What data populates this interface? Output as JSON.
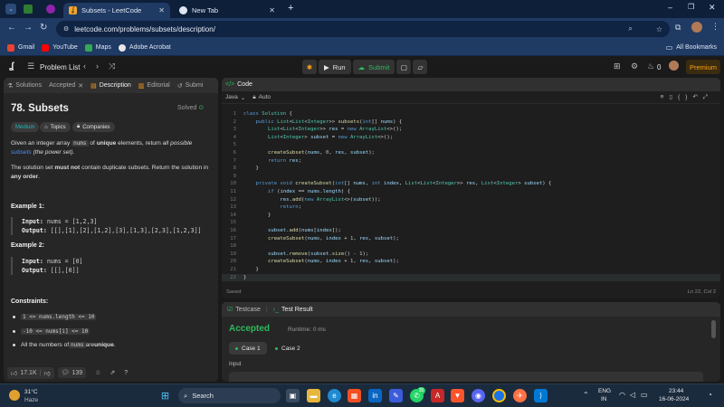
{
  "browser": {
    "tabs": [
      {
        "title": "Subsets - LeetCode",
        "active": true
      },
      {
        "title": "New Tab",
        "active": false
      }
    ],
    "url": "leetcode.com/problems/subsets/description/",
    "bookmarks": [
      {
        "label": "Gmail",
        "color": "#ea4335"
      },
      {
        "label": "YouTube",
        "color": "#ff0000"
      },
      {
        "label": "Maps",
        "color": "#34a853"
      },
      {
        "label": "Adobe Acrobat",
        "color": "#e8e8e8"
      }
    ],
    "all_bookmarks": "All Bookmarks"
  },
  "nav": {
    "problem_list": "Problem List",
    "run": "Run",
    "submit": "Submit",
    "streak": "0",
    "premium": "Premium"
  },
  "left": {
    "tabs": [
      "Solutions",
      "Accepted",
      "Description",
      "Editorial",
      "Submi"
    ],
    "title": "78. Subsets",
    "solved": "Solved",
    "difficulty": "Medium",
    "topics": "Topics",
    "companies": "Companies",
    "desc1_pre": "Given an integer array ",
    "desc1_code": "nums",
    "desc1_mid": " of ",
    "desc1_bold": "unique",
    "desc1_post": " elements, return ",
    "desc1_italic": "all possible",
    "desc1_link": "subsets",
    "desc1_end": " (the power set).",
    "desc2_pre": "The solution set ",
    "desc2_bold1": "must not",
    "desc2_mid": " contain duplicate subsets. Return the solution in ",
    "desc2_bold2": "any order",
    "desc2_end": ".",
    "example1_title": "Example 1:",
    "example1_input_label": "Input:",
    "example1_input": "nums = [1,2,3]",
    "example1_output_label": "Output:",
    "example1_output": "[[],[1],[2],[1,2],[3],[1,3],[2,3],[1,2,3]]",
    "example2_title": "Example 2:",
    "example2_input_label": "Input:",
    "example2_input": "nums = [0]",
    "example2_output_label": "Output:",
    "example2_output": "[[],[0]]",
    "constraints_title": "Constraints:",
    "constraint1": "1 <= nums.length <= 10",
    "constraint2": "-10 <= nums[i] <= 10",
    "constraint3_pre": "All the numbers of ",
    "constraint3_code": "nums",
    "constraint3_post": " are ",
    "constraint3_bold": "unique",
    "constraint3_end": ".",
    "likes": "17.1K",
    "comments": "139"
  },
  "code": {
    "header": "Code",
    "language": "Java",
    "mode": "Auto",
    "saved": "Saved",
    "cursor": "Ln 22, Col 2",
    "current_line": 22,
    "lines": [
      "class Solution {",
      "    public List<List<Integer>> subsets(int[] nums) {",
      "        List<List<Integer>> res = new ArrayList<>();",
      "        List<Integer> subset = new ArrayList<>();",
      "",
      "        createSubset(nums, 0, res, subset);",
      "        return res;",
      "    }",
      "",
      "    private void createSubset(int[] nums, int index, List<List<Integer>> res, List<Integer> subset) {",
      "        if (index == nums.length) {",
      "            res.add(new ArrayList<>(subset));",
      "            return;",
      "        }",
      "",
      "        subset.add(nums[index]);",
      "        createSubset(nums, index + 1, res, subset);",
      "",
      "        subset.remove(subset.size() - 1);",
      "        createSubset(nums, index + 1, res, subset);",
      "    }",
      "}"
    ]
  },
  "test": {
    "tab1": "Testcase",
    "tab2": "Test Result",
    "status": "Accepted",
    "runtime": "Runtime: 0 ms",
    "case1": "Case 1",
    "case2": "Case 2",
    "input_label": "Input"
  },
  "taskbar": {
    "temp": "31°C",
    "weather": "Haze",
    "search": "Search",
    "lang1": "ENG",
    "lang2": "IN",
    "time": "23:44",
    "date": "16-06-2024",
    "badge": "35"
  }
}
